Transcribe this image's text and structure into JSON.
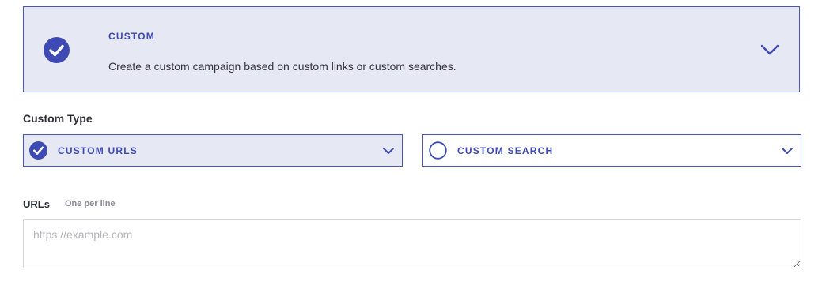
{
  "campaign_card": {
    "title": "CUSTOM",
    "description": "Create a custom campaign based on custom links or custom searches.",
    "icon": "check-circle-icon",
    "selected": true,
    "expand_icon": "chevron-down-icon"
  },
  "custom_type": {
    "label": "Custom Type",
    "options": [
      {
        "label": "CUSTOM URLS",
        "selected": true,
        "icon": "check-circle-icon"
      },
      {
        "label": "CUSTOM SEARCH",
        "selected": false,
        "icon": "radio-empty-icon"
      }
    ]
  },
  "urls_field": {
    "label": "URLs",
    "hint": "One per line",
    "placeholder": "https://example.com",
    "value": ""
  },
  "colors": {
    "accent": "#3e4ab3",
    "selected_bg": "#e6e8f3",
    "border": "#4a55b8"
  }
}
